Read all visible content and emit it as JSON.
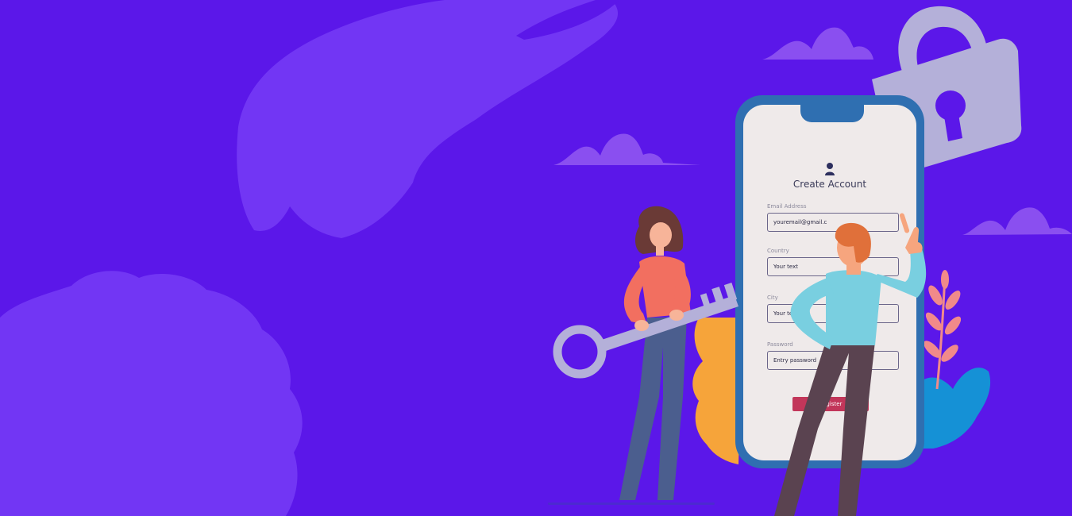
{
  "form": {
    "title": "Create Account",
    "email_label": "Email Address",
    "email_value": "youremail@gmail.c",
    "country_label": "Country",
    "country_placeholder": "Your text",
    "city_label": "City",
    "city_placeholder": "Your text",
    "password_label": "Password",
    "password_placeholder": "Entry password",
    "submit_label": "Register"
  },
  "colors": {
    "background": "#5b17e9",
    "shape": "#7236f4",
    "phone_frame": "#2f6fb1",
    "screen": "#efeaea",
    "register_button": "#c2365a",
    "lock": "#b4b0d9"
  },
  "icons": [
    "user-icon",
    "padlock-icon",
    "key-icon",
    "cloud-icon",
    "leaf-icon"
  ]
}
